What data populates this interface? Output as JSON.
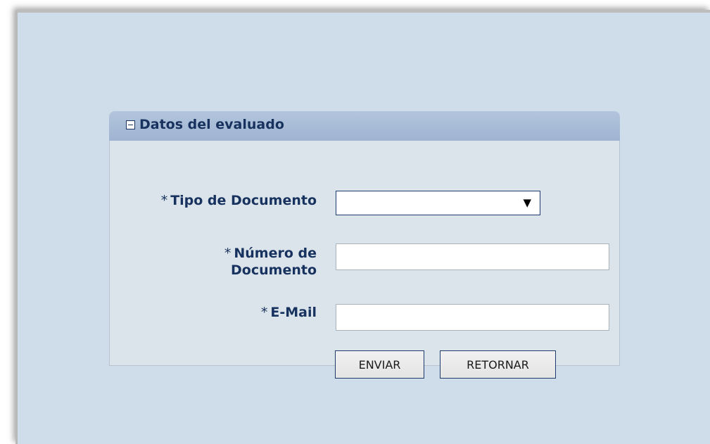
{
  "panel": {
    "title": "Datos del evaluado"
  },
  "form": {
    "tipo_documento": {
      "required_mark": "*",
      "label": "Tipo de Documento",
      "value": ""
    },
    "numero_documento": {
      "required_mark": "*",
      "label_line1": "Número de",
      "label_line2": "Documento",
      "value": ""
    },
    "email": {
      "required_mark": "*",
      "label": "E-Mail",
      "value": ""
    }
  },
  "buttons": {
    "enviar": "ENVIAR",
    "retornar": "RETORNAR"
  },
  "icons": {
    "collapse": "minus-box-icon",
    "dropdown": "triangle-down-icon"
  }
}
